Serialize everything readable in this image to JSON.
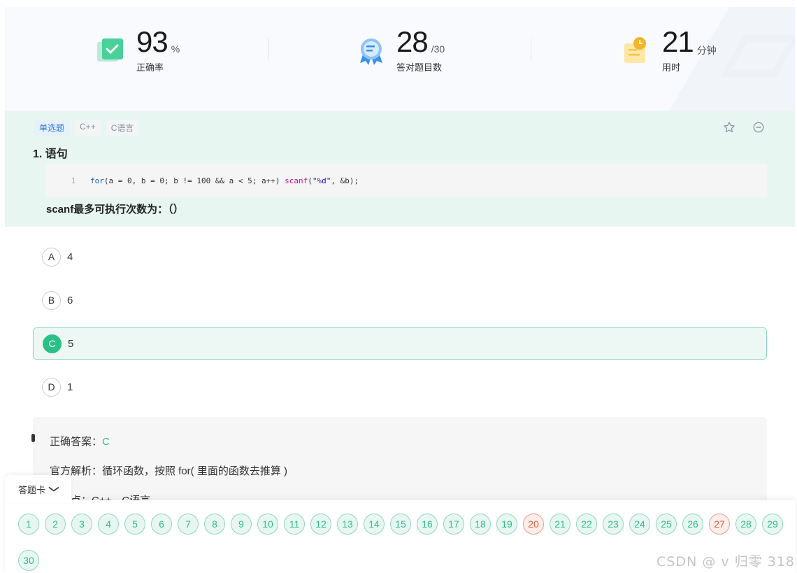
{
  "stats": [
    {
      "value": "93",
      "unit": "%",
      "label": "正确率",
      "icon": "check-card-icon"
    },
    {
      "value": "28",
      "unit": "/30",
      "label": "答对题目数",
      "icon": "medal-icon"
    },
    {
      "value": "21",
      "unit": "分钟",
      "label": "用时",
      "icon": "clock-note-icon"
    }
  ],
  "question": {
    "tags": [
      "单选题",
      "C++",
      "C语言"
    ],
    "title": "1. 语句",
    "code_line_no": "1",
    "code": {
      "kw": "for",
      "body": "(a = 0, b = 0; b != 100 && a < 5; a++) ",
      "fn": "scanf",
      "paren_open": "(",
      "str": "\"%d\"",
      "tail": ", &b);"
    },
    "prompt": "scanf最多可执行次数为：（）",
    "favorite_icon": "star-icon",
    "hide_icon": "minus-circle-icon"
  },
  "options": [
    {
      "letter": "A",
      "value": "4",
      "selected": false
    },
    {
      "letter": "B",
      "value": "6",
      "selected": false
    },
    {
      "letter": "C",
      "value": "5",
      "selected": true
    },
    {
      "letter": "D",
      "value": "1",
      "selected": false
    }
  ],
  "analysis": {
    "answer_label": "正确答案：",
    "answer_value": "C",
    "explain": "官方解析：循环函数，按照 for( 里面的函数去推算 )",
    "knowledge": "知识点：C++，C语言"
  },
  "answer_card": {
    "tab_label": "答题卡",
    "numbers": [
      "1",
      "2",
      "3",
      "4",
      "5",
      "6",
      "7",
      "8",
      "9",
      "10",
      "11",
      "12",
      "13",
      "14",
      "15",
      "16",
      "17",
      "18",
      "19",
      "20",
      "21",
      "22",
      "23",
      "24",
      "25",
      "26",
      "27",
      "28",
      "29",
      "30"
    ],
    "wrong": [
      "20",
      "27"
    ]
  },
  "watermark": "CSDN @  v 归零 318",
  "colors": {
    "accent": "#2bc08a",
    "wrong": "#e85a3c",
    "question_bg": "#e8f6f1"
  }
}
